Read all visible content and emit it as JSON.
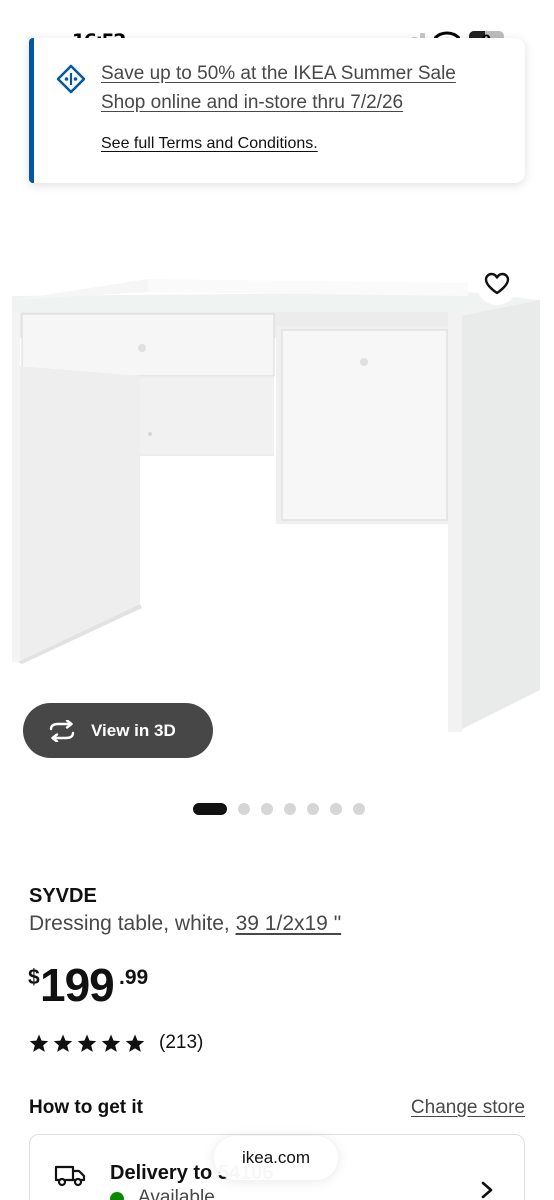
{
  "status_bar": {
    "time": "16:52",
    "battery": "9",
    "signal_bars_active": 2,
    "signal_bars_total": 4
  },
  "promo": {
    "line1": "Save up to 50% at the IKEA Summer Sale",
    "line2": "Shop online and in-store thru 7/2/26",
    "terms": "See full Terms and Conditions.",
    "icon": "sale-tag-icon",
    "accent_color": "#0058a3"
  },
  "gallery": {
    "view_3d_label": "View in 3D",
    "image_count": 7,
    "active_index": 0,
    "wishlist_icon": "heart-icon"
  },
  "product": {
    "name": "SYVDE",
    "description": "Dressing table, white, ",
    "size": "39 1/2x19 \"",
    "price_currency": "$",
    "price_main": "199",
    "price_cents": ".99",
    "rating_stars": 5,
    "rating_count": "(213)"
  },
  "fulfillment": {
    "title": "How to get it",
    "change_store": "Change store",
    "delivery_title": "Delivery to 54106",
    "delivery_status": "Available",
    "status_color": "#0a8a00"
  },
  "browser": {
    "url": "ikea.com"
  }
}
